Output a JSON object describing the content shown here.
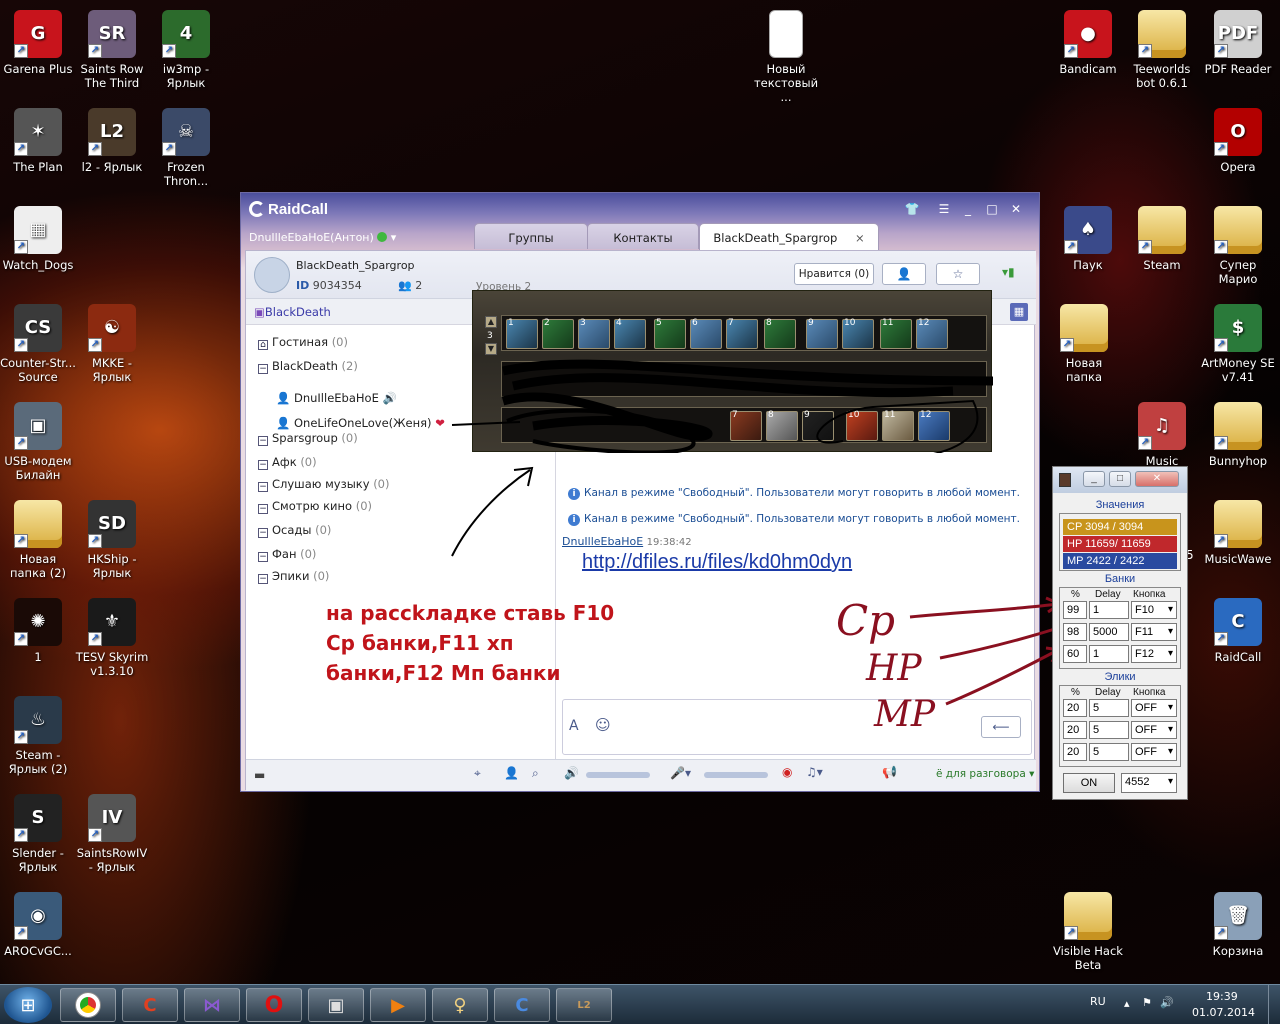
{
  "desktop": {
    "left_icons": [
      {
        "id": "garena",
        "label": "Garena Plus",
        "color": "#c8141c",
        "glyph": "G"
      },
      {
        "id": "saints3",
        "label": "Saints Row The Third",
        "color": "#6d5c7a",
        "glyph": "SR"
      },
      {
        "id": "iw3mp",
        "label": "iw3mp - Ярлык",
        "color": "#2c6b2c",
        "glyph": "4"
      },
      {
        "id": "plan",
        "label": "The Plan",
        "color": "#555",
        "glyph": "✶"
      },
      {
        "id": "l2",
        "label": "l2 - Ярлык",
        "color": "#4a3a2a",
        "glyph": "L2"
      },
      {
        "id": "frozen",
        "label": "Frozen Thron...",
        "color": "#3b4a68",
        "glyph": "☠"
      },
      {
        "id": "watchdogs",
        "label": "Watch_Dogs",
        "color": "#eeeeee",
        "glyph": "▦"
      },
      {
        "id": "cs",
        "label": "Counter-Str... Source",
        "color": "#3a3a3a",
        "glyph": "CS"
      },
      {
        "id": "mkke",
        "label": "MKKE - Ярлык",
        "color": "#8c2a10",
        "glyph": "☯"
      },
      {
        "id": "usbmodem",
        "label": "USB-модем Билайн",
        "color": "#5a6a7a",
        "glyph": "▣"
      },
      {
        "id": "newfolder2",
        "label": "Новая папка (2)",
        "color": "#d9ad3c",
        "glyph": ""
      },
      {
        "id": "hkship",
        "label": "HKShip - Ярлык",
        "color": "#333",
        "glyph": "SD"
      },
      {
        "id": "one",
        "label": "1",
        "color": "#1a0a06",
        "glyph": "✺"
      },
      {
        "id": "skyrim",
        "label": "TESV Skyrim v1.3.10",
        "color": "#1a1a1a",
        "glyph": "⚜"
      },
      {
        "id": "steam2",
        "label": "Steam - Ярлык (2)",
        "color": "#2a3a4a",
        "glyph": "♨"
      },
      {
        "id": "slender",
        "label": "Slender - Ярлык",
        "color": "#222",
        "glyph": "S"
      },
      {
        "id": "saints4",
        "label": "SaintsRowIV - Ярлык",
        "color": "#555",
        "glyph": "IV"
      },
      {
        "id": "arocvgc",
        "label": "AROCvGC...",
        "color": "#3a5a7a",
        "glyph": "◉"
      }
    ],
    "top_center_icon": {
      "label": "Новый текстовый ..."
    },
    "right_icons": [
      {
        "id": "bandicam",
        "label": "Bandicam",
        "color": "#c8141c",
        "glyph": "●"
      },
      {
        "id": "teeworlds",
        "label": "Teeworlds bot 0.6.1",
        "color": "#d9ad3c",
        "glyph": ""
      },
      {
        "id": "pdf",
        "label": "PDF Reader",
        "color": "#d0d0d0",
        "glyph": "PDF"
      },
      {
        "id": "opera",
        "label": "Opera",
        "color": "#b30000",
        "glyph": "O"
      },
      {
        "id": "pauk",
        "label": "Паук",
        "color": "#3a4a8a",
        "glyph": "♠"
      },
      {
        "id": "steam",
        "label": "Steam",
        "color": "#d9ad3c",
        "glyph": ""
      },
      {
        "id": "supermario",
        "label": "Супер Марио",
        "color": "#d9ad3c",
        "glyph": ""
      },
      {
        "id": "newfolder",
        "label": "Новая папка",
        "color": "#d9ad3c",
        "glyph": ""
      },
      {
        "id": "artmoney",
        "label": "ArtMoney SE v7.41",
        "color": "#2a7a3a",
        "glyph": "$"
      },
      {
        "id": "music",
        "label": "Music",
        "color": "#c04040",
        "glyph": "♫"
      },
      {
        "id": "bunnyhop",
        "label": "Bunnyhop",
        "color": "#d9ad3c",
        "glyph": ""
      },
      {
        "id": "musicwawe",
        "label": "MusicWawe",
        "color": "#d9ad3c",
        "glyph": ""
      },
      {
        "id": "raidcall",
        "label": "RaidCall",
        "color": "#2a6ac0",
        "glyph": "C"
      },
      {
        "id": "visiblehack",
        "label": "Visible Hack Beta",
        "color": "#d9ad3c",
        "glyph": ""
      },
      {
        "id": "trash",
        "label": "Корзина",
        "color": "#8aa0b8",
        "glyph": "🗑"
      }
    ],
    "stray_digit": "5"
  },
  "raidcall": {
    "title": "RaidCall",
    "user": "DnuIlleEbaHoE(Антон)",
    "tabs": [
      "Группы",
      "Контакты",
      "BlackDeath_Spargrop"
    ],
    "tab_close": "×",
    "group_name": "BlackDeath_Spargrop",
    "group_id_label": "ID",
    "group_id": "9034354",
    "members": "2",
    "level_partial": "Уровень 2",
    "like_button": "Нравится (0)",
    "room_name": "BlackDeath",
    "channels": [
      {
        "name": "Гостиная",
        "count": "(0)",
        "sign": "⌂"
      },
      {
        "name": "BlackDeath",
        "count": "(2)",
        "sign": "−"
      },
      {
        "name": "Sparsgroup",
        "count": "(0)",
        "sign": "−"
      },
      {
        "name": "Афк",
        "count": "(0)",
        "sign": "−"
      },
      {
        "name": "Слушаю музыку",
        "count": "(0)",
        "sign": "−"
      },
      {
        "name": "Смотрю кино",
        "count": "(0)",
        "sign": "−"
      },
      {
        "name": "Осады",
        "count": "(0)",
        "sign": "−"
      },
      {
        "name": "Фан",
        "count": "(0)",
        "sign": "−"
      },
      {
        "name": "Эпики",
        "count": "(0)",
        "sign": "−"
      }
    ],
    "members_list": [
      "DnuIlleEbaHoE",
      "OneLifeOneLove(Женя)"
    ],
    "system_messages": [
      "Канал в режиме \"Свободный\". Пользователи могут говорить в любой момент.",
      "Канал в режиме \"Свободный\". Пользователи могут говорить в любой момент."
    ],
    "msg_author": "DnuIlleEbaHoE",
    "msg_time": "19:38:42",
    "msg_link": "http://dfiles.ru/files/kd0hm0dyn",
    "talk_mode": "ё для разговора"
  },
  "game_bar": {
    "row1": [
      "1",
      "2",
      "3",
      "4",
      "5",
      "6",
      "7",
      "8",
      "9",
      "10",
      "11",
      "12"
    ],
    "row3": [
      "7",
      "8",
      "9",
      "10",
      "11",
      "12"
    ],
    "side_number": "3"
  },
  "bot": {
    "values_title": "Значения",
    "cp": "CP  3094  /  3094",
    "hp": "HP  11659/  11659",
    "mp": "MP  2422  /  2422",
    "banks_title": "Банки",
    "col_headers": [
      "%",
      "Delay",
      "Кнопка"
    ],
    "banks": [
      {
        "pct": "99",
        "delay": "1",
        "key": "F10"
      },
      {
        "pct": "98",
        "delay": "5000",
        "key": "F11"
      },
      {
        "pct": "60",
        "delay": "1",
        "key": "F12"
      }
    ],
    "elixirs_title": "Элики",
    "elixirs": [
      {
        "pct": "20",
        "delay": "5",
        "key": "OFF"
      },
      {
        "pct": "20",
        "delay": "5",
        "key": "OFF"
      },
      {
        "pct": "20",
        "delay": "5",
        "key": "OFF"
      }
    ],
    "on_button": "ON",
    "port": "4552",
    "colors": {
      "cp": "#c8941c",
      "hp": "#c0282c",
      "mp": "#2a4aa0"
    }
  },
  "annotations": {
    "text_lines": [
      "на рассkладке ставь F10",
      "Cp банки,F11 хп",
      "банки,F12 Мп банки"
    ],
    "cp": "Cp",
    "hp": "HP",
    "mp": "MP"
  },
  "taskbar": {
    "lang": "RU",
    "time": "19:39",
    "date": "01.07.2014",
    "apps": [
      "chrome-icon",
      "ccleaner-icon",
      "vs-icon",
      "opera-icon",
      "game-icon",
      "media-icon",
      "lineage-girl-icon",
      "raidcall-icon",
      "lineage-icon"
    ]
  }
}
